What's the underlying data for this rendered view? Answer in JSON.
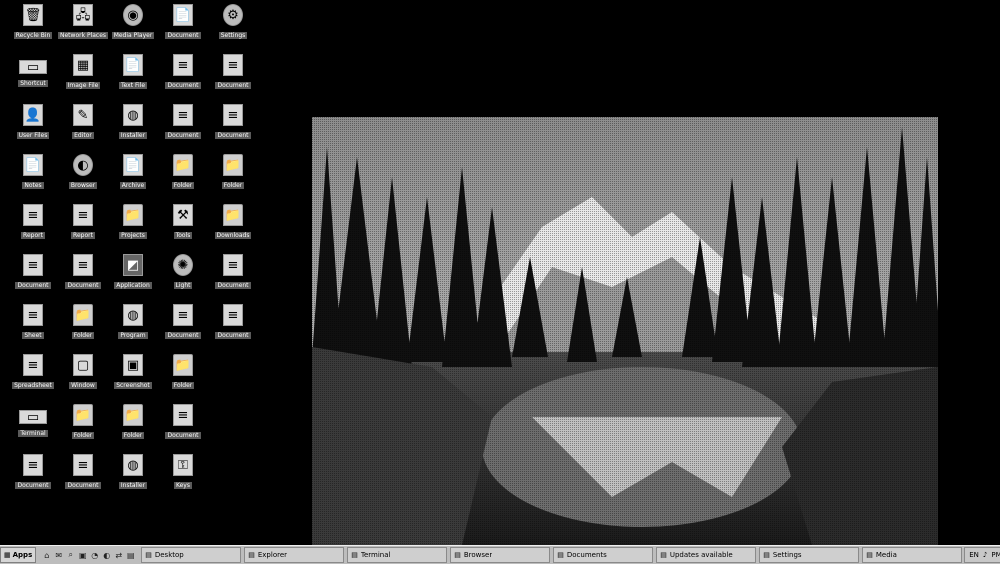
{
  "desktop": {
    "icons": [
      {
        "label": "Recycle Bin",
        "glyph": "🗑",
        "kind": "doc"
      },
      {
        "label": "Network Places",
        "glyph": "🖧",
        "kind": "doc"
      },
      {
        "label": "Media Player",
        "glyph": "◉",
        "kind": "round"
      },
      {
        "label": "Document",
        "glyph": "📄",
        "kind": "doc"
      },
      {
        "label": "Settings",
        "glyph": "⚙",
        "kind": "round"
      },
      {
        "label": "Shortcut",
        "glyph": "▭",
        "kind": "wide"
      },
      {
        "label": "Image File",
        "glyph": "▦",
        "kind": "doc"
      },
      {
        "label": "Text File",
        "glyph": "📄",
        "kind": "doc"
      },
      {
        "label": "Document",
        "glyph": "≡",
        "kind": "doc"
      },
      {
        "label": "Document",
        "glyph": "≡",
        "kind": "doc"
      },
      {
        "label": "User Files",
        "glyph": "👤",
        "kind": "doc"
      },
      {
        "label": "Editor",
        "glyph": "✎",
        "kind": "doc"
      },
      {
        "label": "Installer",
        "glyph": "◍",
        "kind": "doc"
      },
      {
        "label": "Document",
        "glyph": "≡",
        "kind": "doc"
      },
      {
        "label": "Document",
        "glyph": "≡",
        "kind": "doc"
      },
      {
        "label": "Notes",
        "glyph": "📄",
        "kind": "doc"
      },
      {
        "label": "Browser",
        "glyph": "◐",
        "kind": "round"
      },
      {
        "label": "Archive",
        "glyph": "📄",
        "kind": "doc"
      },
      {
        "label": "Folder",
        "glyph": "📁",
        "kind": "folder"
      },
      {
        "label": "Folder",
        "glyph": "📁",
        "kind": "folder"
      },
      {
        "label": "Report",
        "glyph": "≡",
        "kind": "doc"
      },
      {
        "label": "Report",
        "glyph": "≡",
        "kind": "doc"
      },
      {
        "label": "Projects",
        "glyph": "📁",
        "kind": "folder"
      },
      {
        "label": "Tools",
        "glyph": "⚒",
        "kind": "doc"
      },
      {
        "label": "Downloads",
        "glyph": "📁",
        "kind": "folder"
      },
      {
        "label": "Document",
        "glyph": "≡",
        "kind": "doc"
      },
      {
        "label": "Document",
        "glyph": "≡",
        "kind": "doc"
      },
      {
        "label": "Application",
        "glyph": "◩",
        "kind": "dark"
      },
      {
        "label": "Light",
        "glyph": "✺",
        "kind": "round"
      },
      {
        "label": "Document",
        "glyph": "≡",
        "kind": "doc"
      },
      {
        "label": "Sheet",
        "glyph": "≡",
        "kind": "doc"
      },
      {
        "label": "Folder",
        "glyph": "📁",
        "kind": "folder"
      },
      {
        "label": "Program",
        "glyph": "◍",
        "kind": "doc"
      },
      {
        "label": "Document",
        "glyph": "≡",
        "kind": "doc"
      },
      {
        "label": "Document",
        "glyph": "≡",
        "kind": "doc"
      },
      {
        "label": "Spreadsheet",
        "glyph": "≡",
        "kind": "doc"
      },
      {
        "label": "Window",
        "glyph": "▢",
        "kind": "doc"
      },
      {
        "label": "Screenshot",
        "glyph": "▣",
        "kind": "doc"
      },
      {
        "label": "Folder",
        "glyph": "📁",
        "kind": "folder"
      },
      {
        "label": "",
        "glyph": "",
        "kind": "none"
      },
      {
        "label": "Terminal",
        "glyph": "▭",
        "kind": "wide"
      },
      {
        "label": "Folder",
        "glyph": "📁",
        "kind": "folder"
      },
      {
        "label": "Folder",
        "glyph": "📁",
        "kind": "folder"
      },
      {
        "label": "Document",
        "glyph": "≡",
        "kind": "doc"
      },
      {
        "label": "",
        "glyph": "",
        "kind": "none"
      },
      {
        "label": "Document",
        "glyph": "≡",
        "kind": "doc"
      },
      {
        "label": "Document",
        "glyph": "≡",
        "kind": "doc"
      },
      {
        "label": "Installer",
        "glyph": "◍",
        "kind": "doc"
      },
      {
        "label": "Keys",
        "glyph": "⚿",
        "kind": "doc"
      },
      {
        "label": "",
        "glyph": "",
        "kind": "none"
      }
    ]
  },
  "taskbar": {
    "start_label": "Apps",
    "quicklaunch": [
      "⌂",
      "✉",
      "⌕",
      "▣",
      "◔",
      "◐",
      "⇄",
      "▤"
    ],
    "tasks": [
      {
        "label": "Desktop",
        "icon": "▤"
      },
      {
        "label": "Explorer",
        "icon": "▤"
      },
      {
        "label": "Terminal",
        "icon": "▤"
      },
      {
        "label": "Browser",
        "icon": "▤"
      },
      {
        "label": "Documents",
        "icon": "▤"
      },
      {
        "label": "Updates available",
        "icon": "▤"
      },
      {
        "label": "Settings",
        "icon": "▤"
      },
      {
        "label": "Media",
        "icon": "▤"
      }
    ],
    "tray": {
      "lang": "EN",
      "volume": "♪",
      "clock": "PM"
    }
  }
}
